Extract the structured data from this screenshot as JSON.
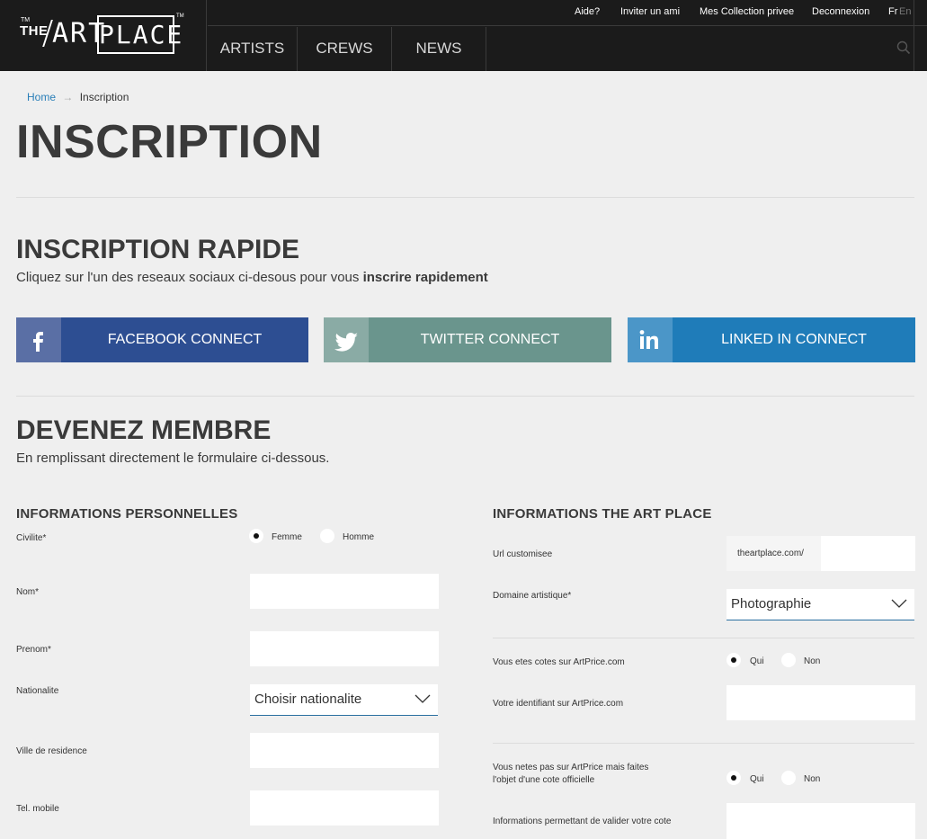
{
  "header": {
    "logo": {
      "the": "THE",
      "tm_top": "TM",
      "art": "ART",
      "place": "PLACE",
      "tm": "TM"
    },
    "top_links": [
      "Aide?",
      "Inviter un ami",
      "Mes Collection privee",
      "Deconnexion"
    ],
    "lang_fr": "Fr",
    "lang_en": "En",
    "main_nav": [
      "ARTISTS",
      "CREWS",
      "NEWS"
    ]
  },
  "breadcrumb": {
    "home": "Home",
    "separator": "→",
    "current": "Inscription"
  },
  "page_title": "INSCRIPTION",
  "quick": {
    "title": "INSCRIPTION RAPIDE",
    "subtitle_prefix": "Cliquez sur l'un des reseaux sociaux ci-desous pour vous ",
    "subtitle_bold": "inscrire rapidement",
    "buttons": [
      {
        "label": "FACEBOOK CONNECT",
        "icon": "facebook-icon",
        "color": "#2d4e92",
        "icon_bg": "#5a6fa5"
      },
      {
        "label": "TWITTER CONNECT",
        "icon": "twitter-icon",
        "color": "#6a958d",
        "icon_bg": "#8aaba5"
      },
      {
        "label": "LINKED IN CONNECT",
        "icon": "linkedin-icon",
        "color": "#1f7cb9",
        "icon_bg": "#4b96c8"
      }
    ]
  },
  "member": {
    "title": "DEVENEZ MEMBRE",
    "subtitle": "En remplissant directement le formulaire ci-dessous."
  },
  "personal": {
    "title": "INFORMATIONS PERSONNELLES",
    "civilite_label": "Civilite*",
    "civilite_options": [
      "Femme",
      "Homme"
    ],
    "civilite_selected": "Femme",
    "nom_label": "Nom*",
    "prenom_label": "Prenom*",
    "nationalite_label": "Nationalite",
    "nationalite_value": "Choisir nationalite",
    "ville_label": "Ville de residence",
    "tel_label": "Tel. mobile"
  },
  "artplace": {
    "title": "INFORMATIONS THE ART PLACE",
    "url_label": "Url customisee",
    "url_prefix": "theartplace.com/",
    "domaine_label": "Domaine artistique*",
    "domaine_value": "Photographie",
    "cotes_label": "Vous etes cotes sur ArtPrice.com",
    "cotes_options": [
      "Qui",
      "Non"
    ],
    "cotes_selected": "Qui",
    "identifiant_label": "Votre identifiant sur ArtPrice.com",
    "pas_label_1": "Vous netes pas sur ArtPrice mais faites",
    "pas_label_2": "l'objet d'une cote officielle",
    "pas_options": [
      "Qui",
      "Non"
    ],
    "pas_selected": "Qui",
    "valider_label": "Informations permettant de valider votre cote"
  },
  "colors": {
    "header_bg": "#1b1b1b",
    "page_bg": "#efefef",
    "link": "#2a7fb8",
    "title": "#3a3a3a"
  }
}
